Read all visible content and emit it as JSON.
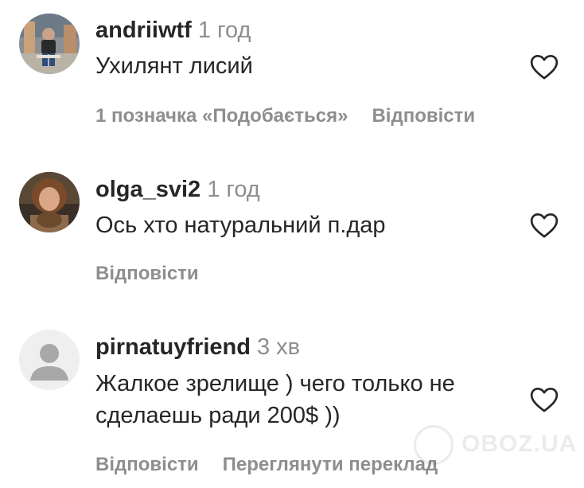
{
  "comments": [
    {
      "username": "andriiwtf",
      "time": "1 год",
      "text": "Ухилянт лисий",
      "likes": "1 позначка «Подобається»",
      "reply": "Відповісти"
    },
    {
      "username": "olga_svi2",
      "time": "1 год",
      "text": "Ось хто натуральний п.дар",
      "reply": "Відповісти"
    },
    {
      "username": "pirnatuyfriend",
      "time": "3 хв",
      "text_line1": "Жалкое зрелище ) чего только не",
      "text_line2": "сделаешь ради 200$ ))",
      "reply": "Відповісти",
      "translate": "Переглянути переклад"
    }
  ],
  "watermark": "OBOZ.UA",
  "colors": {
    "text": "#262626",
    "secondary": "#8e8e8e",
    "default_avatar_bg": "#dbdbdb",
    "default_avatar_fg": "#ffffff"
  },
  "icons": [
    "heart-outline-icon",
    "default-avatar-icon"
  ]
}
